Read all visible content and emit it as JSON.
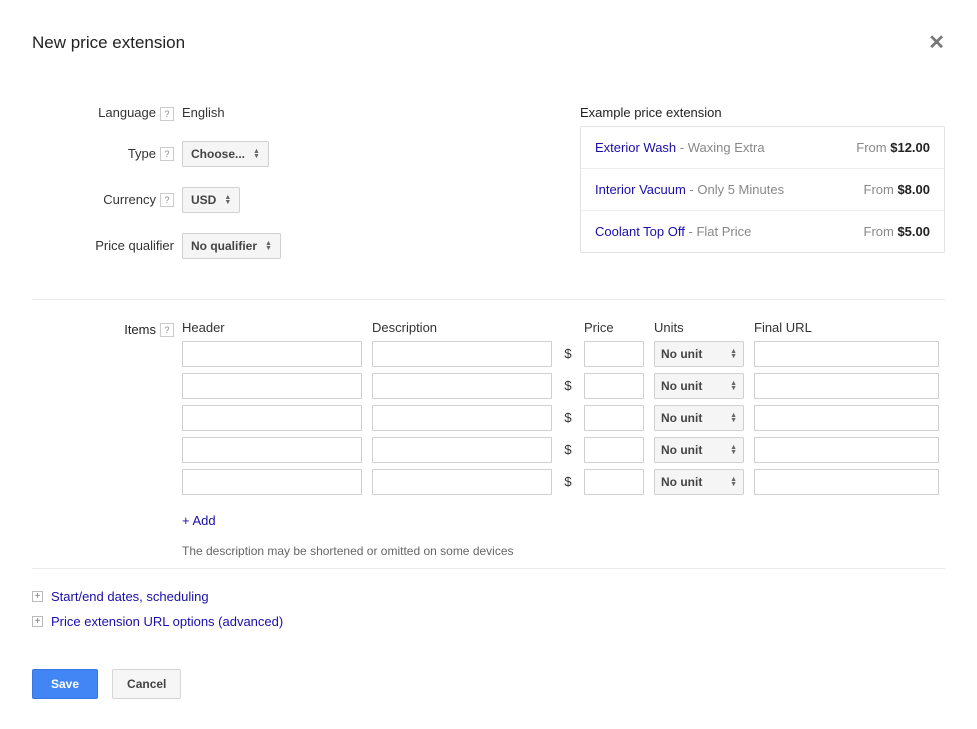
{
  "header": {
    "title": "New price extension"
  },
  "form": {
    "language_label": "Language",
    "language_value": "English",
    "type_label": "Type",
    "type_value": "Choose...",
    "currency_label": "Currency",
    "currency_value": "USD",
    "qualifier_label": "Price qualifier",
    "qualifier_value": "No qualifier"
  },
  "example": {
    "title": "Example price extension",
    "rows": [
      {
        "link": "Exterior Wash",
        "desc": "Waxing Extra",
        "from": "From ",
        "price": "$12.00"
      },
      {
        "link": "Interior Vacuum",
        "desc": "Only 5 Minutes",
        "from": "From ",
        "price": "$8.00"
      },
      {
        "link": "Coolant Top Off",
        "desc": "Flat Price",
        "from": "From ",
        "price": "$5.00"
      }
    ]
  },
  "items": {
    "label": "Items",
    "headers": {
      "header": "Header",
      "description": "Description",
      "price": "Price",
      "units": "Units",
      "final_url": "Final URL"
    },
    "currency_symbol": "$",
    "unit_value": "No unit",
    "row_count": 5,
    "add_label": "+ Add",
    "note": "The description may be shortened or omitted on some devices"
  },
  "expandables": {
    "scheduling": "Start/end dates, scheduling",
    "url_options": "Price extension URL options (advanced)"
  },
  "buttons": {
    "save": "Save",
    "cancel": "Cancel"
  }
}
